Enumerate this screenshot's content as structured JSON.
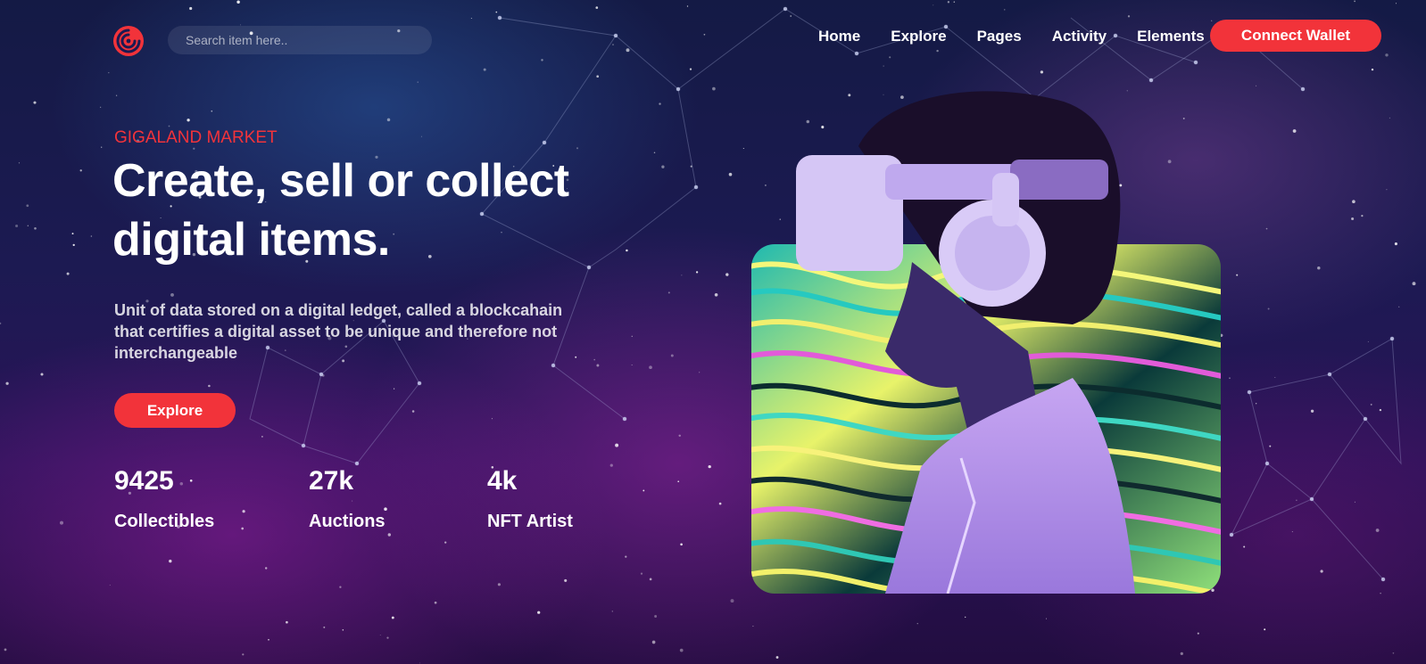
{
  "header": {
    "search": {
      "placeholder": "Search item here.."
    },
    "nav": [
      "Home",
      "Explore",
      "Pages",
      "Activity",
      "Elements"
    ],
    "connect_label": "Connect Wallet"
  },
  "hero": {
    "eyebrow": "GIGALAND MARKET",
    "title_line1": "Create, sell or collect",
    "title_line2": "digital items.",
    "description": "Unit of data stored on a digital ledget, called a blockcahain that certifies a digital asset to be unique and therefore not interchangeable",
    "explore_label": "Explore",
    "stats": [
      {
        "value": "9425",
        "label": "Collectibles"
      },
      {
        "value": "27k",
        "label": "Auctions"
      },
      {
        "value": "4k",
        "label": "NFT Artist"
      }
    ]
  },
  "colors": {
    "accent": "#f2333a",
    "text": "#ffffff",
    "background": "#1c1a52"
  },
  "icons": {
    "logo": "swirl-logo-icon"
  }
}
